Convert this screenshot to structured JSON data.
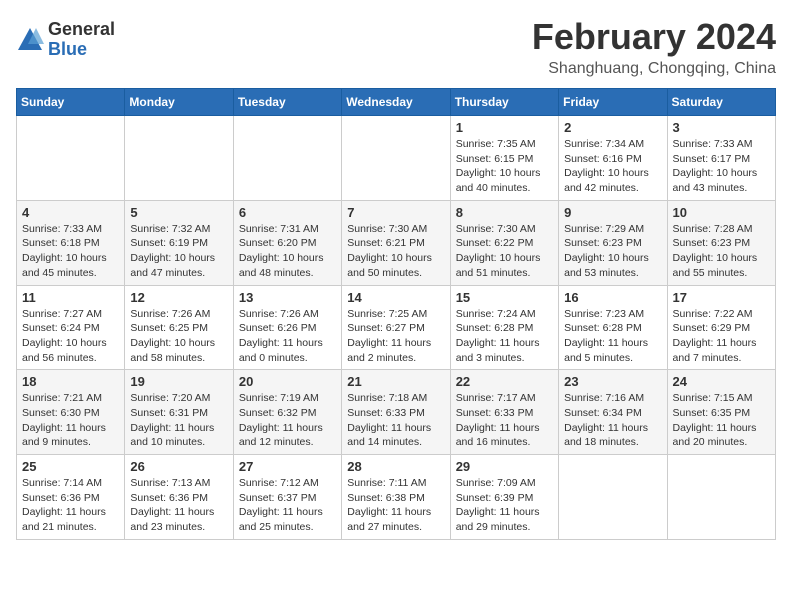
{
  "logo": {
    "general": "General",
    "blue": "Blue"
  },
  "header": {
    "month": "February 2024",
    "location": "Shanghuang, Chongqing, China"
  },
  "weekdays": [
    "Sunday",
    "Monday",
    "Tuesday",
    "Wednesday",
    "Thursday",
    "Friday",
    "Saturday"
  ],
  "weeks": [
    [
      {
        "day": "",
        "info": ""
      },
      {
        "day": "",
        "info": ""
      },
      {
        "day": "",
        "info": ""
      },
      {
        "day": "",
        "info": ""
      },
      {
        "day": "1",
        "info": "Sunrise: 7:35 AM\nSunset: 6:15 PM\nDaylight: 10 hours\nand 40 minutes."
      },
      {
        "day": "2",
        "info": "Sunrise: 7:34 AM\nSunset: 6:16 PM\nDaylight: 10 hours\nand 42 minutes."
      },
      {
        "day": "3",
        "info": "Sunrise: 7:33 AM\nSunset: 6:17 PM\nDaylight: 10 hours\nand 43 minutes."
      }
    ],
    [
      {
        "day": "4",
        "info": "Sunrise: 7:33 AM\nSunset: 6:18 PM\nDaylight: 10 hours\nand 45 minutes."
      },
      {
        "day": "5",
        "info": "Sunrise: 7:32 AM\nSunset: 6:19 PM\nDaylight: 10 hours\nand 47 minutes."
      },
      {
        "day": "6",
        "info": "Sunrise: 7:31 AM\nSunset: 6:20 PM\nDaylight: 10 hours\nand 48 minutes."
      },
      {
        "day": "7",
        "info": "Sunrise: 7:30 AM\nSunset: 6:21 PM\nDaylight: 10 hours\nand 50 minutes."
      },
      {
        "day": "8",
        "info": "Sunrise: 7:30 AM\nSunset: 6:22 PM\nDaylight: 10 hours\nand 51 minutes."
      },
      {
        "day": "9",
        "info": "Sunrise: 7:29 AM\nSunset: 6:23 PM\nDaylight: 10 hours\nand 53 minutes."
      },
      {
        "day": "10",
        "info": "Sunrise: 7:28 AM\nSunset: 6:23 PM\nDaylight: 10 hours\nand 55 minutes."
      }
    ],
    [
      {
        "day": "11",
        "info": "Sunrise: 7:27 AM\nSunset: 6:24 PM\nDaylight: 10 hours\nand 56 minutes."
      },
      {
        "day": "12",
        "info": "Sunrise: 7:26 AM\nSunset: 6:25 PM\nDaylight: 10 hours\nand 58 minutes."
      },
      {
        "day": "13",
        "info": "Sunrise: 7:26 AM\nSunset: 6:26 PM\nDaylight: 11 hours\nand 0 minutes."
      },
      {
        "day": "14",
        "info": "Sunrise: 7:25 AM\nSunset: 6:27 PM\nDaylight: 11 hours\nand 2 minutes."
      },
      {
        "day": "15",
        "info": "Sunrise: 7:24 AM\nSunset: 6:28 PM\nDaylight: 11 hours\nand 3 minutes."
      },
      {
        "day": "16",
        "info": "Sunrise: 7:23 AM\nSunset: 6:28 PM\nDaylight: 11 hours\nand 5 minutes."
      },
      {
        "day": "17",
        "info": "Sunrise: 7:22 AM\nSunset: 6:29 PM\nDaylight: 11 hours\nand 7 minutes."
      }
    ],
    [
      {
        "day": "18",
        "info": "Sunrise: 7:21 AM\nSunset: 6:30 PM\nDaylight: 11 hours\nand 9 minutes."
      },
      {
        "day": "19",
        "info": "Sunrise: 7:20 AM\nSunset: 6:31 PM\nDaylight: 11 hours\nand 10 minutes."
      },
      {
        "day": "20",
        "info": "Sunrise: 7:19 AM\nSunset: 6:32 PM\nDaylight: 11 hours\nand 12 minutes."
      },
      {
        "day": "21",
        "info": "Sunrise: 7:18 AM\nSunset: 6:33 PM\nDaylight: 11 hours\nand 14 minutes."
      },
      {
        "day": "22",
        "info": "Sunrise: 7:17 AM\nSunset: 6:33 PM\nDaylight: 11 hours\nand 16 minutes."
      },
      {
        "day": "23",
        "info": "Sunrise: 7:16 AM\nSunset: 6:34 PM\nDaylight: 11 hours\nand 18 minutes."
      },
      {
        "day": "24",
        "info": "Sunrise: 7:15 AM\nSunset: 6:35 PM\nDaylight: 11 hours\nand 20 minutes."
      }
    ],
    [
      {
        "day": "25",
        "info": "Sunrise: 7:14 AM\nSunset: 6:36 PM\nDaylight: 11 hours\nand 21 minutes."
      },
      {
        "day": "26",
        "info": "Sunrise: 7:13 AM\nSunset: 6:36 PM\nDaylight: 11 hours\nand 23 minutes."
      },
      {
        "day": "27",
        "info": "Sunrise: 7:12 AM\nSunset: 6:37 PM\nDaylight: 11 hours\nand 25 minutes."
      },
      {
        "day": "28",
        "info": "Sunrise: 7:11 AM\nSunset: 6:38 PM\nDaylight: 11 hours\nand 27 minutes."
      },
      {
        "day": "29",
        "info": "Sunrise: 7:09 AM\nSunset: 6:39 PM\nDaylight: 11 hours\nand 29 minutes."
      },
      {
        "day": "",
        "info": ""
      },
      {
        "day": "",
        "info": ""
      }
    ]
  ]
}
